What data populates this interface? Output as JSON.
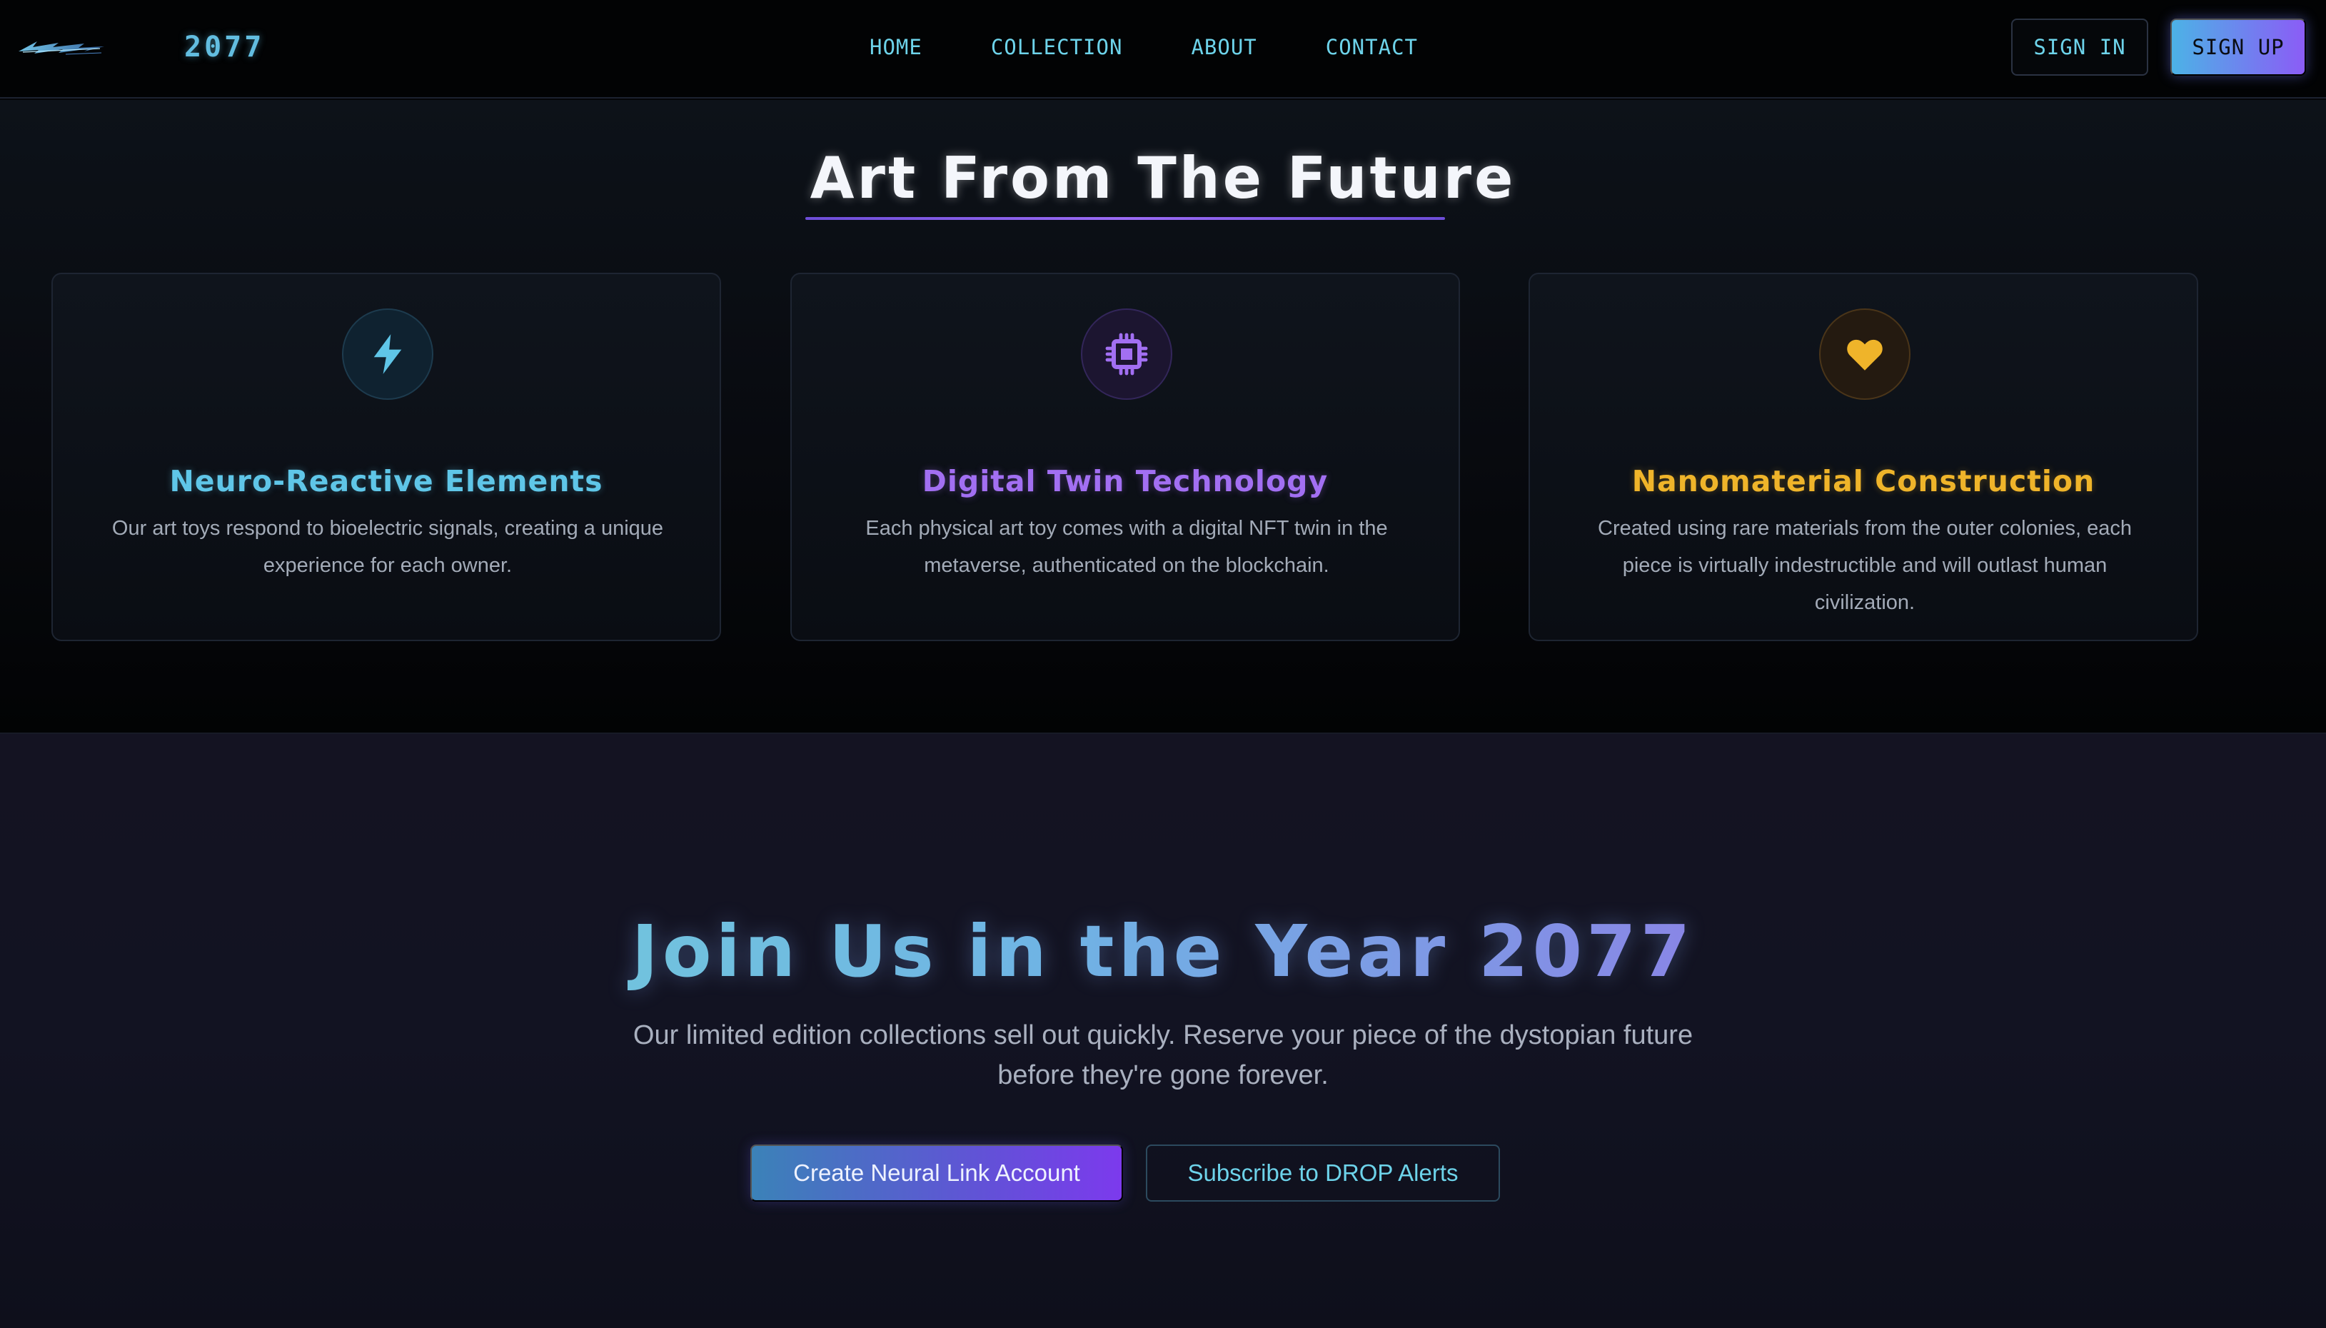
{
  "nav": {
    "logo_icon": "cyberpunk-logo",
    "brand": "2077",
    "links": [
      "HOME",
      "COLLECTION",
      "ABOUT",
      "CONTACT"
    ],
    "sign_in": "SIGN IN",
    "sign_up": "SIGN UP"
  },
  "features": {
    "title": "Art From The Future",
    "cards": [
      {
        "icon": "lightning-bolt-icon",
        "color": "#5fc6e8",
        "title": "Neuro-Reactive Elements",
        "text": "Our art toys respond to bioelectric signals, creating a unique experience for each owner."
      },
      {
        "icon": "chip-icon",
        "color": "#a26ff2",
        "title": "Digital Twin Technology",
        "text": "Each physical art toy comes with a digital NFT twin in the metaverse, authenticated on the blockchain."
      },
      {
        "icon": "heart-icon",
        "color": "#efb42a",
        "title": "Nanomaterial Construction",
        "text": "Created using rare materials from the outer colonies, each piece is virtually indestructible and will outlast human civilization."
      }
    ]
  },
  "cta": {
    "title": "Join Us in the Year 2077",
    "text": "Our limited edition collections sell out quickly. Reserve your piece of the dystopian future before they're gone forever.",
    "primary_button": "Create Neural Link Account",
    "secondary_button": "Subscribe to DROP Alerts"
  },
  "colors": {
    "accent_cyan": "#6dd3ea",
    "accent_purple": "#8b5cf6",
    "accent_gold": "#efb42a",
    "background": "#050608"
  }
}
